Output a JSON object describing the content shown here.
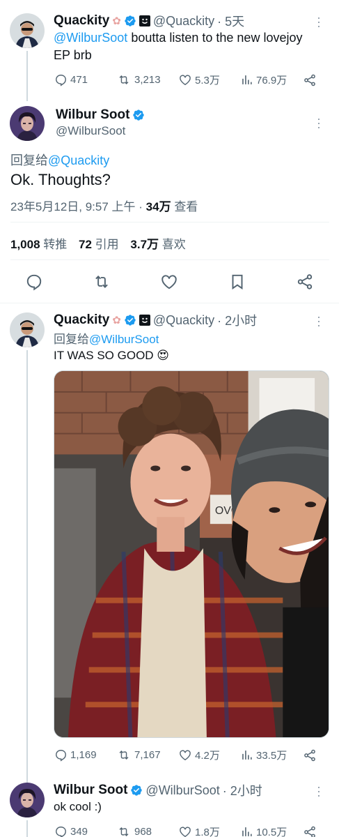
{
  "tweet1": {
    "name": "Quackity",
    "handle": "@Quackity",
    "time": "· 5天",
    "mention": "@WilburSoot",
    "text_line1": " boutta listen to the new lovejoy",
    "text_line2": "EP brb",
    "replies": "471",
    "retweets": "3,213",
    "likes": "5.3万",
    "views": "76.9万"
  },
  "main": {
    "name": "Wilbur Soot",
    "handle": "@WilburSoot",
    "reply_prefix": "回复给",
    "reply_to": "@Quackity",
    "text": "Ok. Thoughts?",
    "datetime": "23年5月12日, 9:57 上午 ·",
    "views_count": "34万",
    "views_label": "查看",
    "retweets_count": "1,008",
    "retweets_label": "转推",
    "quotes_count": "72",
    "quotes_label": "引用",
    "likes_count": "3.7万",
    "likes_label": "喜欢"
  },
  "tweet3": {
    "name": "Quackity",
    "handle": "@Quackity",
    "time": "· 2小时",
    "reply_prefix": "回复给",
    "reply_to": "@WilburSoot",
    "text": "IT WAS SO GOOD 😍",
    "replies": "1,169",
    "retweets": "7,167",
    "likes": "4.2万",
    "views": "33.5万",
    "photo_sign_text": "OVO"
  },
  "tweet4": {
    "name": "Wilbur Soot",
    "handle": "@WilburSoot",
    "time": "· 2小时",
    "text": "ok cool :)",
    "replies": "349",
    "retweets": "968",
    "likes": "1.8万",
    "views": "10.5万"
  },
  "colors": {
    "accent": "#1d9bf0",
    "text": "#0f1419",
    "muted": "#536471",
    "verified": "#1d9bf0"
  }
}
